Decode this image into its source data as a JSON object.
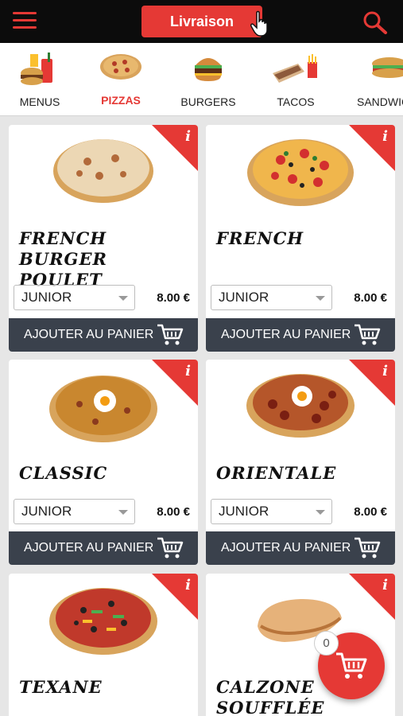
{
  "header": {
    "livraison_label": "Livraison"
  },
  "categories": [
    {
      "label": "MENUS",
      "icon": "menu-combo-icon",
      "active": false
    },
    {
      "label": "PIZZAS",
      "icon": "pizza-icon",
      "active": true
    },
    {
      "label": "BURGERS",
      "icon": "burger-icon",
      "active": false
    },
    {
      "label": "TACOS",
      "icon": "tacos-icon",
      "active": false
    },
    {
      "label": "SANDWICHES",
      "icon": "sandwich-icon",
      "active": false
    }
  ],
  "products": [
    {
      "name": "FRENCH BURGER POULET",
      "size": "JUNIOR",
      "price": "8.00 €",
      "add_label": "AJOUTER AU PANIER"
    },
    {
      "name": "FRENCH",
      "size": "JUNIOR",
      "price": "8.00 €",
      "add_label": "AJOUTER AU PANIER"
    },
    {
      "name": "CLASSIC",
      "size": "JUNIOR",
      "price": "8.00 €",
      "add_label": "AJOUTER AU PANIER"
    },
    {
      "name": "ORIENTALE",
      "size": "JUNIOR",
      "price": "8.00 €",
      "add_label": "AJOUTER AU PANIER"
    },
    {
      "name": "TEXANE",
      "size": "",
      "price": "",
      "add_label": ""
    },
    {
      "name": "CALZONE SOUFFLÉE",
      "size": "",
      "price": "",
      "add_label": ""
    }
  ],
  "info_label": "i",
  "cart": {
    "count": "0"
  },
  "colors": {
    "accent": "#e53935",
    "dark": "#3a414c",
    "topbar": "#0c0c0c"
  }
}
